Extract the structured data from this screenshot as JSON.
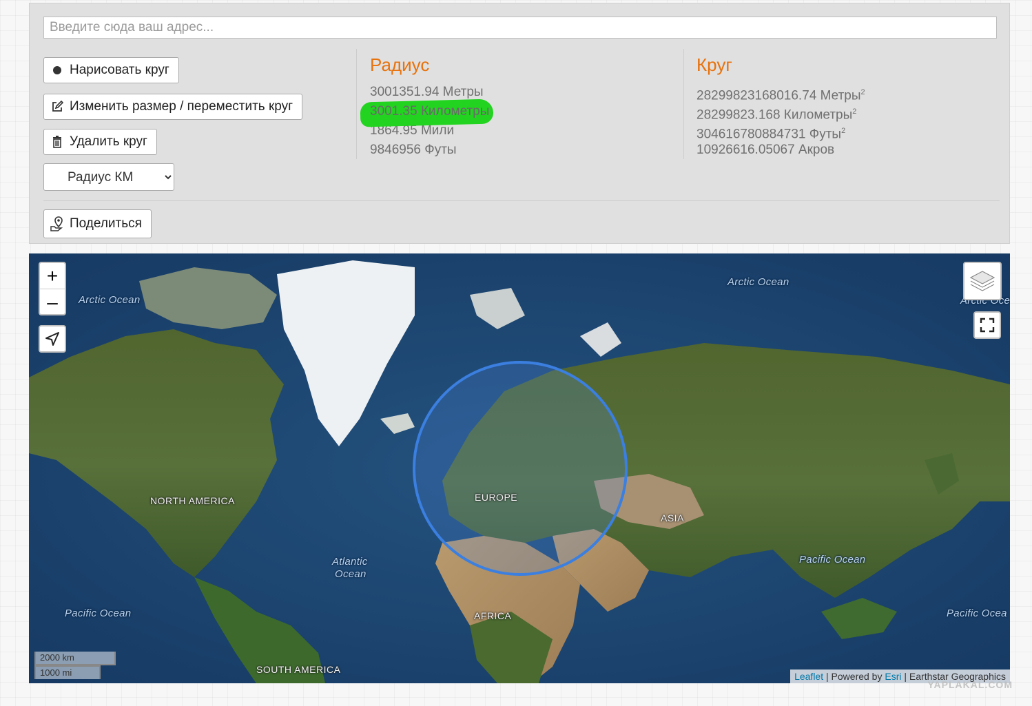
{
  "address": {
    "placeholder": "Введите сюда ваш адрес..."
  },
  "buttons": {
    "draw": "Нарисовать круг",
    "edit": "Изменить размер / переместить круг",
    "delete": "Удалить круг",
    "share": "Поделиться"
  },
  "unit_select": {
    "selected": "Радиус КМ"
  },
  "radius": {
    "title": "Радиус",
    "meters": "3001351.94 Метры",
    "kilometers": "3001.35 Километры",
    "miles": "1864.95 Мили",
    "feet": "9846956 Футы"
  },
  "circle": {
    "title": "Круг",
    "sq_meters": "28299823168016.74 Метры",
    "sq_kilometers": "28299823.168 Километры",
    "sq_feet": "304616780884731 Футы",
    "acres": "10926616.05067 Акров",
    "square_sup": "2"
  },
  "map": {
    "zoom_in": "+",
    "zoom_out": "–",
    "labels": {
      "arctic_w": "Arctic Ocean",
      "arctic_e": "Arctic Ocean",
      "arctic_edge": "Arctic Oce",
      "north_america": "NORTH AMERICA",
      "europe": "EUROPE",
      "asia": "ASIA",
      "africa": "AFRICA",
      "south_america": "SOUTH AMERICA",
      "atlantic_1": "Atlantic",
      "atlantic_2": "Ocean",
      "pacific_w": "Pacific Ocean",
      "pacific_e": "Pacific Ocean",
      "pacific_edge": "Pacific Ocea"
    },
    "scale_km": "2000 km",
    "scale_mi": "1000 mi",
    "attribution": {
      "leaflet": "Leaflet",
      "powered": "| Powered by",
      "esri": "Esri",
      "source": "| Earthstar Geographics"
    }
  },
  "watermark": "YAPLAKAL.COM",
  "colors": {
    "accent": "#e8720c",
    "highlight": "#22d31f",
    "circle": "#3b7fe0"
  }
}
